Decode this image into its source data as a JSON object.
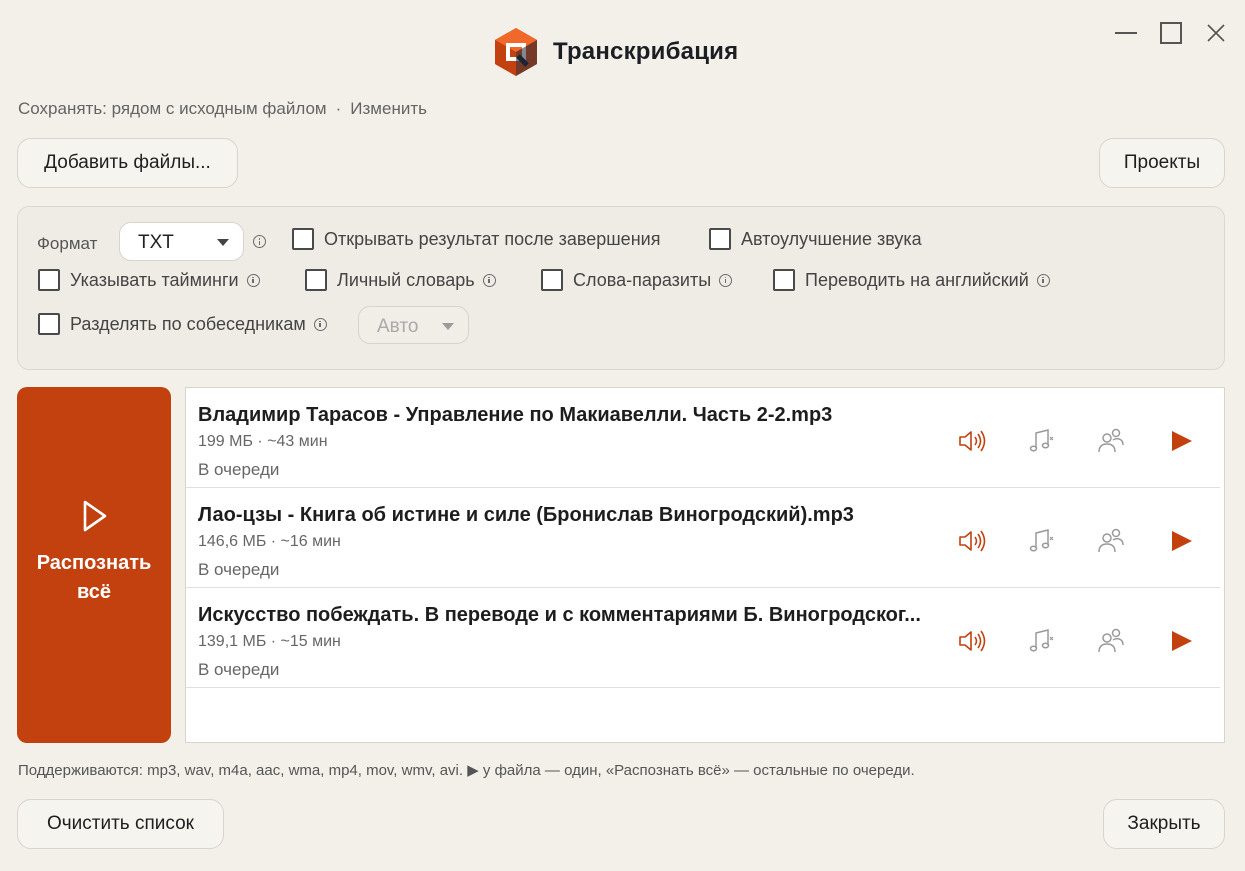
{
  "window": {
    "title": "Транскрибация",
    "controls": [
      "minimize",
      "maximize",
      "close"
    ]
  },
  "save": {
    "label": "Сохранять: рядом с исходным файлом",
    "separator": "·",
    "change_link": "Изменить"
  },
  "toolbar": {
    "add_files": "Добавить файлы...",
    "projects": "Проекты"
  },
  "options": {
    "format_label": "Формат",
    "format_value": "TXT",
    "open_result": "Открывать результат после завершения",
    "auto_enhance": "Автоулучшение звука",
    "timings": "Указывать тайминги",
    "dictionary": "Личный словарь",
    "fillers": "Слова-паразиты",
    "translate_en": "Переводить на английский",
    "speakers": "Разделять по собеседникам",
    "speakers_value": "Авто"
  },
  "run_all": {
    "label": "Распознать всё"
  },
  "files": [
    {
      "name": "Владимир Тарасов - Управление по Макиавелли. Часть 2-2.mp3",
      "meta": "199 МБ · ~43 мин",
      "status": "В очереди"
    },
    {
      "name": "Лао-цзы - Книга об истине и силе (Бронислав Виногродский).mp3",
      "meta": "146,6 МБ · ~16 мин",
      "status": "В очереди"
    },
    {
      "name": "Искусство побеждать. В переводе и с комментариями Б. Виногродског...",
      "meta": "139,1 МБ · ~15 мин",
      "status": "В очереди"
    }
  ],
  "icons": {
    "accent": "#c2410f",
    "muted": "#9a9a9a"
  },
  "footnote": "Поддерживаются: mp3, wav, m4a, aac, wma, mp4, mov, wmv, avi. ▶ у файла — один, «Распознать всё» — остальные по очереди.",
  "bottom": {
    "clear": "Очистить список",
    "close": "Закрыть"
  }
}
